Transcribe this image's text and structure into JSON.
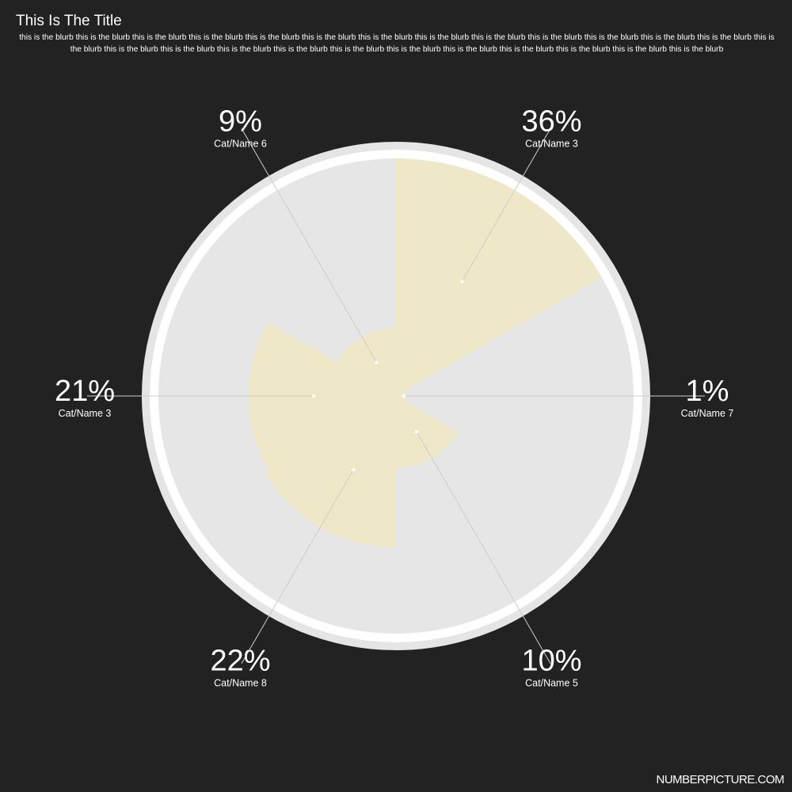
{
  "chart_data": {
    "type": "polar-area",
    "title": "This Is The Title",
    "blurb": "this is the blurb this is the blurb this is the blurb this is the blurb this is the blurb this is the blurb this is the blurb this is the blurb this is the blurb this is the blurb this is the blurb this is the blurb this is the blurb this is the blurb this is the blurb this is the blurb this is the blurb this is the blurb this is the blurb this is the blurb this is the blurb this is the blurb this is the blurb this is the blurb this is the blurb",
    "slices": [
      {
        "label": "Cat/Name 3",
        "percent": 36,
        "display": "36%",
        "value": 1.0
      },
      {
        "label": "Cat/Name 7",
        "percent": 1,
        "display": "1%",
        "value": 0.0
      },
      {
        "label": "Cat/Name 5",
        "percent": 10,
        "display": "10%",
        "value": 0.27
      },
      {
        "label": "Cat/Name 8",
        "percent": 22,
        "display": "22%",
        "value": 0.62
      },
      {
        "label": "Cat/Name 3",
        "percent": 21,
        "display": "21%",
        "value": 0.6
      },
      {
        "label": "Cat/Name 6",
        "percent": 9,
        "display": "9%",
        "value": 0.25
      }
    ],
    "colors": {
      "background": "#222222",
      "outer_ring": "#e5e5e5",
      "inner_ring": "#ffffff",
      "plot_area": "#e6e6e6",
      "slice_fill": "#efe8c8",
      "leader_line": "#cccccc",
      "text": "#ffffff"
    }
  },
  "footer": {
    "brand": "NUMBERPICTURE.COM"
  }
}
